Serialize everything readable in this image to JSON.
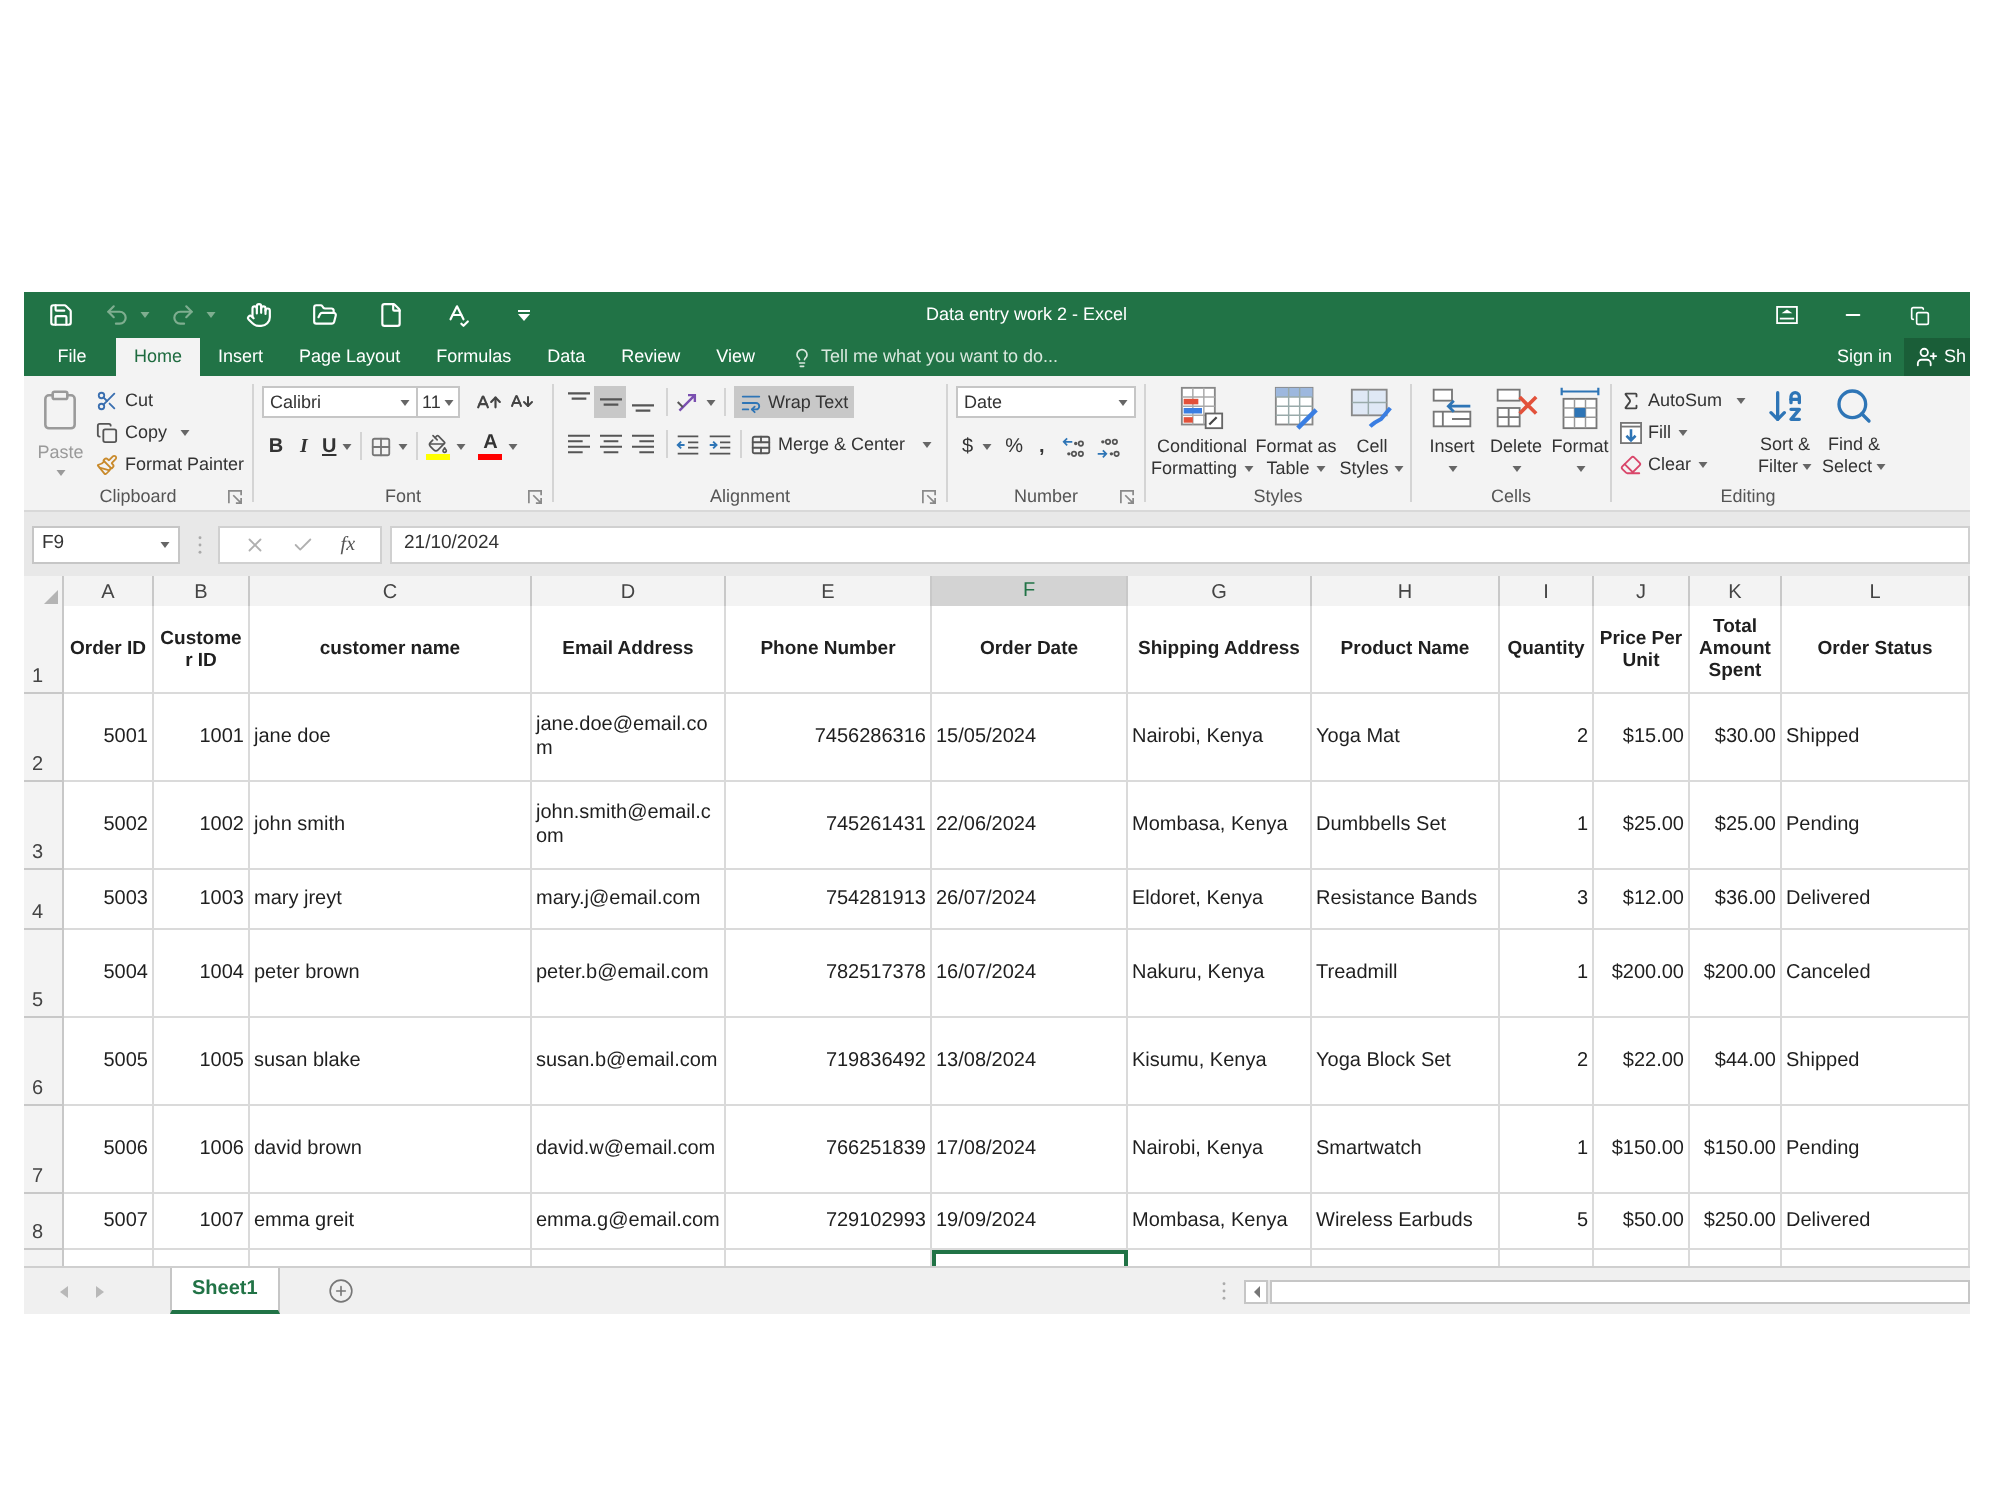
{
  "window": {
    "title": "Data entry work 2 - Excel",
    "sign_in": "Sign in",
    "share": "Sh"
  },
  "quick_access": [
    {
      "kind": "save",
      "disabled": false
    },
    {
      "kind": "undo",
      "disabled": true
    },
    {
      "kind": "redo",
      "disabled": true
    },
    {
      "kind": "touch",
      "disabled": false
    },
    {
      "kind": "open",
      "disabled": false
    },
    {
      "kind": "new",
      "disabled": false
    },
    {
      "kind": "spelling",
      "disabled": false
    },
    {
      "kind": "customize",
      "disabled": false
    }
  ],
  "ribbon_tabs": [
    {
      "label": "File",
      "selected": false
    },
    {
      "label": "Home",
      "selected": true
    },
    {
      "label": "Insert",
      "selected": false
    },
    {
      "label": "Page Layout",
      "selected": false
    },
    {
      "label": "Formulas",
      "selected": false
    },
    {
      "label": "Data",
      "selected": false
    },
    {
      "label": "Review",
      "selected": false
    },
    {
      "label": "View",
      "selected": false
    }
  ],
  "tell_me": {
    "placeholder": "Tell me what you want to do..."
  },
  "clipboard": {
    "label": "Clipboard",
    "paste": {
      "label": "Paste",
      "disabled": true
    },
    "cut": "Cut",
    "copy": "Copy",
    "format_painter": "Format Painter"
  },
  "font": {
    "label": "Font",
    "name": "Calibri",
    "size": "11",
    "bold": "B",
    "italic": "I",
    "underline": "U",
    "font_color": "A"
  },
  "alignment": {
    "label": "Alignment",
    "vertical": [
      {
        "kind": "top",
        "selected": false
      },
      {
        "kind": "middle",
        "selected": true
      },
      {
        "kind": "bottom",
        "selected": false
      }
    ],
    "horizontal": [
      {
        "kind": "left",
        "selected": false
      },
      {
        "kind": "center",
        "selected": false
      },
      {
        "kind": "right",
        "selected": false
      }
    ],
    "wrap_text": {
      "label": "Wrap Text",
      "on": true
    },
    "merge": "Merge & Center"
  },
  "number": {
    "label": "Number",
    "format": "Date",
    "currency": "$",
    "percent": "%",
    "comma": ","
  },
  "styles": {
    "label": "Styles",
    "buttons": [
      {
        "kind": "conditional",
        "label": "Conditional Formatting"
      },
      {
        "kind": "table",
        "label": "Format as Table"
      },
      {
        "kind": "cell_styles",
        "label": "Cell Styles"
      }
    ]
  },
  "cells": {
    "label": "Cells",
    "buttons": [
      {
        "kind": "insert",
        "label": "Insert"
      },
      {
        "kind": "delete",
        "label": "Delete"
      },
      {
        "kind": "format",
        "label": "Format"
      }
    ]
  },
  "editing": {
    "label": "Editing",
    "autosum": "AutoSum",
    "fill": "Fill",
    "clear": "Clear",
    "sort": "Sort & Filter",
    "find": "Find & Select"
  },
  "formula_bar": {
    "name_box": "F9",
    "function_symbol": "fx",
    "value": "21/10/2024"
  },
  "sheet": {
    "columns": [
      {
        "letter": "A",
        "kind": "number",
        "selected": false
      },
      {
        "letter": "B",
        "kind": "number",
        "selected": false
      },
      {
        "letter": "C",
        "kind": "text",
        "selected": false
      },
      {
        "letter": "D",
        "kind": "text",
        "selected": false
      },
      {
        "letter": "E",
        "kind": "number",
        "selected": false
      },
      {
        "letter": "F",
        "kind": "text",
        "selected": true
      },
      {
        "letter": "G",
        "kind": "text",
        "selected": false
      },
      {
        "letter": "H",
        "kind": "text",
        "selected": false
      },
      {
        "letter": "I",
        "kind": "number",
        "selected": false
      },
      {
        "letter": "J",
        "kind": "number",
        "selected": false
      },
      {
        "letter": "K",
        "kind": "number",
        "selected": false
      },
      {
        "letter": "L",
        "kind": "text",
        "selected": false
      }
    ],
    "rows": [
      {
        "number": "1",
        "kind": "header",
        "cells": [
          "Order ID",
          "Customer ID",
          "customer name",
          "Email Address",
          "Phone Number",
          "Order Date",
          "Shipping Address",
          "Product Name",
          "Quantity",
          "Price Per Unit",
          "Total Amount Spent",
          "Order Status"
        ]
      },
      {
        "number": "2",
        "kind": "data",
        "cells": [
          "5001",
          "1001",
          "jane doe",
          "jane.doe@email.com",
          "7456286316",
          "15/05/2024",
          "Nairobi, Kenya",
          "Yoga Mat",
          "2",
          "$15.00",
          "$30.00",
          "Shipped"
        ]
      },
      {
        "number": "3",
        "kind": "data",
        "cells": [
          "5002",
          "1002",
          "john smith",
          "john.smith@email.com",
          "745261431",
          "22/06/2024",
          "Mombasa, Kenya",
          "Dumbbells Set",
          "1",
          "$25.00",
          "$25.00",
          "Pending"
        ]
      },
      {
        "number": "4",
        "kind": "data",
        "cells": [
          "5003",
          "1003",
          "mary jreyt",
          "mary.j@email.com",
          "754281913",
          "26/07/2024",
          "Eldoret, Kenya",
          "Resistance Bands",
          "3",
          "$12.00",
          "$36.00",
          "Delivered"
        ]
      },
      {
        "number": "5",
        "kind": "data",
        "cells": [
          "5004",
          "1004",
          "peter brown",
          "peter.b@email.com",
          "782517378",
          "16/07/2024",
          "Nakuru, Kenya",
          "Treadmill",
          "1",
          "$200.00",
          "$200.00",
          "Canceled"
        ]
      },
      {
        "number": "6",
        "kind": "data",
        "cells": [
          "5005",
          "1005",
          "susan blake",
          "susan.b@email.com",
          "719836492",
          "13/08/2024",
          "Kisumu, Kenya",
          "Yoga Block Set",
          "2",
          "$22.00",
          "$44.00",
          "Shipped"
        ]
      },
      {
        "number": "7",
        "kind": "data",
        "cells": [
          "5006",
          "1006",
          "david brown",
          "david.w@email.com",
          "766251839",
          "17/08/2024",
          "Nairobi, Kenya",
          "Smartwatch",
          "1",
          "$150.00",
          "$150.00",
          "Pending"
        ]
      },
      {
        "number": "8",
        "kind": "data",
        "cells": [
          "5007",
          "1007",
          "emma greit",
          "emma.g@email.com",
          "729102993",
          "19/09/2024",
          "Mombasa, Kenya",
          "Wireless Earbuds",
          "5",
          "$50.00",
          "$250.00",
          "Delivered"
        ]
      }
    ]
  },
  "sheet_tabs": [
    {
      "label": "Sheet1",
      "selected": true
    }
  ]
}
